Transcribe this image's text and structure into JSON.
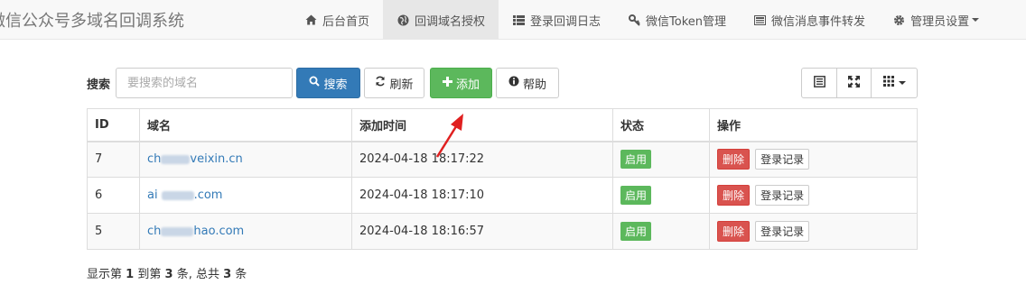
{
  "brand": "微信公众号多域名回调系统",
  "nav": [
    {
      "label": "后台首页",
      "icon": "home-icon"
    },
    {
      "label": "回调域名授权",
      "icon": "globe-icon",
      "active": true
    },
    {
      "label": "登录回调日志",
      "icon": "list-icon"
    },
    {
      "label": "微信Token管理",
      "icon": "key-icon"
    },
    {
      "label": "微信消息事件转发",
      "icon": "newspaper-icon"
    },
    {
      "label": "管理员设置",
      "icon": "gear-icon",
      "dropdown": true
    }
  ],
  "toolbar": {
    "search_label": "搜索",
    "search_placeholder": "要搜索的域名",
    "search_button": "搜索",
    "refresh_button": "刷新",
    "add_button": "添加",
    "help_button": "帮助"
  },
  "table": {
    "headers": [
      "ID",
      "域名",
      "添加时间",
      "状态",
      "操作"
    ],
    "rows": [
      {
        "id": "7",
        "domain_prefix": "ch",
        "domain_suffix": "veixin.cn",
        "time": "2024-04-18 18:17:22",
        "status": "启用"
      },
      {
        "id": "6",
        "domain_prefix": "ai",
        "domain_suffix": ".com",
        "time": "2024-04-18 18:17:10",
        "status": "启用"
      },
      {
        "id": "5",
        "domain_prefix": "ch",
        "domain_suffix": "hao.com",
        "time": "2024-04-18 18:16:57",
        "status": "启用"
      }
    ],
    "delete_label": "删除",
    "log_label": "登录记录"
  },
  "pagination": {
    "prefix": "显示第",
    "from": "1",
    "mid1": "到第",
    "to": "3",
    "mid2": "条, 总共",
    "total": "3",
    "suffix": "条"
  },
  "colors": {
    "primary": "#337ab7",
    "success": "#5cb85c",
    "danger": "#d9534f",
    "annotation_arrow": "#e02020"
  }
}
